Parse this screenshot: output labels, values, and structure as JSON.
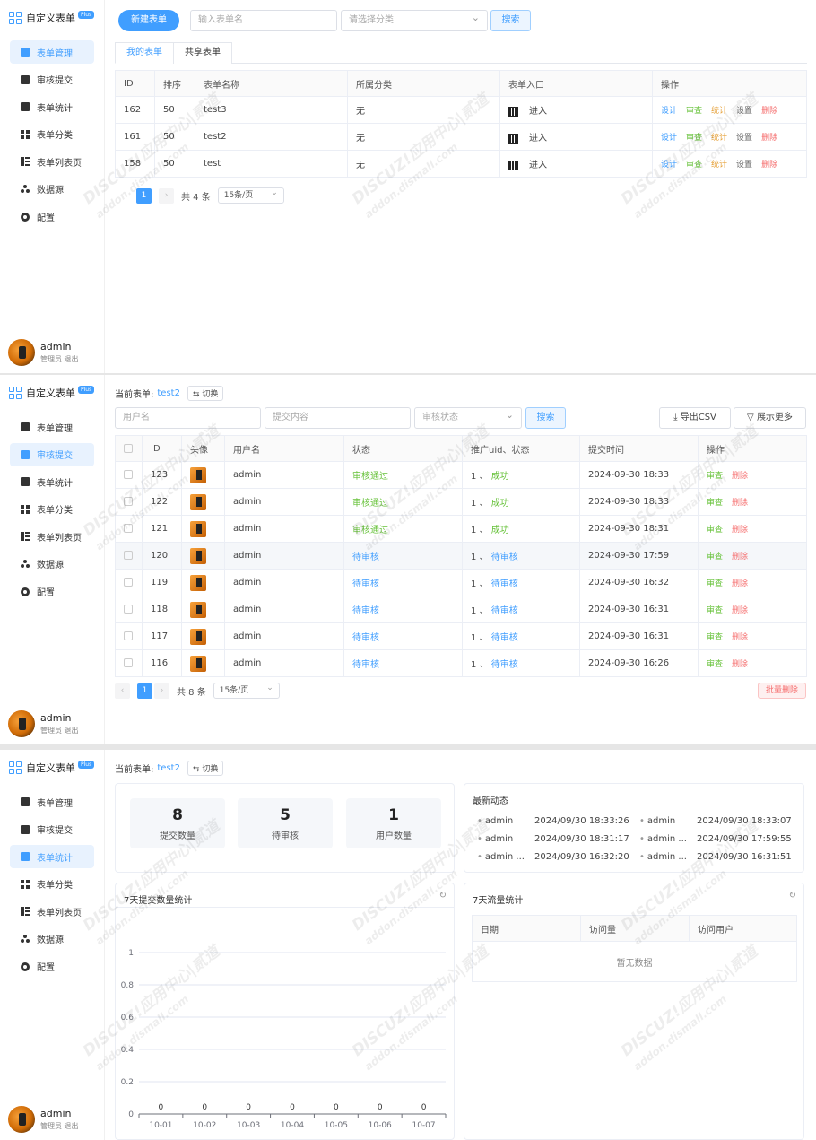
{
  "app": {
    "title": "自定义表单",
    "badge": "Plus"
  },
  "sidebar": {
    "items": [
      {
        "label": "表单管理",
        "icon": "form-icon"
      },
      {
        "label": "审核提交",
        "icon": "audit-icon"
      },
      {
        "label": "表单统计",
        "icon": "chart-icon"
      },
      {
        "label": "表单分类",
        "icon": "category-icon"
      },
      {
        "label": "表单列表页",
        "icon": "list-icon"
      },
      {
        "label": "数据源",
        "icon": "datasource-icon"
      },
      {
        "label": "配置",
        "icon": "gear-icon"
      }
    ]
  },
  "user": {
    "name": "admin",
    "role": "管理员",
    "logout": "退出"
  },
  "watermark": {
    "brand": "DISCUZ!应用中心",
    "site": "addon.dismall.com",
    "mark": "贰道"
  },
  "forms": {
    "new_button": "新建表单",
    "name_placeholder": "输入表单名",
    "category_placeholder": "请选择分类",
    "search": "搜索",
    "tabs": [
      "我的表单",
      "共享表单"
    ],
    "columns": [
      "ID",
      "排序",
      "表单名称",
      "所属分类",
      "表单入口",
      "操作"
    ],
    "rows": [
      {
        "id": "162",
        "order": "50",
        "name": "test3",
        "category": "无",
        "entry": "进入"
      },
      {
        "id": "161",
        "order": "50",
        "name": "test2",
        "category": "无",
        "entry": "进入"
      },
      {
        "id": "158",
        "order": "50",
        "name": "test",
        "category": "无",
        "entry": "进入"
      }
    ],
    "ops": [
      "设计",
      "审查",
      "统计",
      "设置",
      "删除"
    ],
    "pager": {
      "page": "1",
      "total": "共 4 条",
      "size": "15条/页"
    }
  },
  "submissions": {
    "current_label": "当前表单:",
    "current_form": "test2",
    "switch": "切换",
    "user_placeholder": "用户名",
    "content_placeholder": "提交内容",
    "status_placeholder": "审核状态",
    "search": "搜索",
    "export": "导出CSV",
    "more": "展示更多",
    "columns": [
      "ID",
      "头像",
      "用户名",
      "状态",
      "推广uid、状态",
      "提交时间",
      "操作"
    ],
    "rows": [
      {
        "id": "123",
        "user": "admin",
        "status": "审核通过",
        "uid": "1",
        "sep": "、",
        "promo": "成功",
        "time": "2024-09-30 18:33"
      },
      {
        "id": "122",
        "user": "admin",
        "status": "审核通过",
        "uid": "1",
        "sep": "、",
        "promo": "成功",
        "time": "2024-09-30 18:33"
      },
      {
        "id": "121",
        "user": "admin",
        "status": "审核通过",
        "uid": "1",
        "sep": "、",
        "promo": "成功",
        "time": "2024-09-30 18:31"
      },
      {
        "id": "120",
        "user": "admin",
        "status": "待审核",
        "uid": "1",
        "sep": "、",
        "promo": "待审核",
        "time": "2024-09-30 17:59"
      },
      {
        "id": "119",
        "user": "admin",
        "status": "待审核",
        "uid": "1",
        "sep": "、",
        "promo": "待审核",
        "time": "2024-09-30 16:32"
      },
      {
        "id": "118",
        "user": "admin",
        "status": "待审核",
        "uid": "1",
        "sep": "、",
        "promo": "待审核",
        "time": "2024-09-30 16:31"
      },
      {
        "id": "117",
        "user": "admin",
        "status": "待审核",
        "uid": "1",
        "sep": "、",
        "promo": "待审核",
        "time": "2024-09-30 16:31"
      },
      {
        "id": "116",
        "user": "admin",
        "status": "待审核",
        "uid": "1",
        "sep": "、",
        "promo": "待审核",
        "time": "2024-09-30 16:26"
      }
    ],
    "ops": [
      "审查",
      "删除"
    ],
    "pager": {
      "page": "1",
      "total": "共 8 条",
      "size": "15条/页"
    },
    "batch_delete": "批量删除"
  },
  "stats": {
    "current_label": "当前表单:",
    "current_form": "test2",
    "switch": "切换",
    "cards": [
      {
        "value": "8",
        "label": "提交数量"
      },
      {
        "value": "5",
        "label": "待审核"
      },
      {
        "value": "1",
        "label": "用户数量"
      }
    ],
    "feed_title": "最新动态",
    "feed": [
      {
        "user": "admin",
        "time": "2024/09/30 18:33:26"
      },
      {
        "user": "admin",
        "time": "2024/09/30 18:33:07"
      },
      {
        "user": "admin",
        "time": "2024/09/30 18:31:17"
      },
      {
        "user": "admin ...",
        "time": "2024/09/30 17:59:55"
      },
      {
        "user": "admin ...",
        "time": "2024/09/30 16:32:20"
      },
      {
        "user": "admin ...",
        "time": "2024/09/30 16:31:51"
      }
    ],
    "chart_title": "7天提交数量统计",
    "traffic_title": "7天流量统计",
    "traffic_columns": [
      "日期",
      "访问量",
      "访问用户"
    ],
    "traffic_empty": "暂无数据"
  },
  "chart_data": {
    "type": "bar",
    "title": "7天提交数量统计",
    "categories": [
      "10-01",
      "10-02",
      "10-03",
      "10-04",
      "10-05",
      "10-06",
      "10-07"
    ],
    "values": [
      0,
      0,
      0,
      0,
      0,
      0,
      0
    ],
    "yticks": [
      "0",
      "0.2",
      "0.4",
      "0.6",
      "0.8",
      "1"
    ],
    "ylim": [
      0,
      1
    ],
    "grid": true,
    "colors": {
      "axis": "#6e7079",
      "grid": "#e0e6f1"
    }
  },
  "colors": {
    "primary": "#409eff",
    "success": "#67c23a",
    "warning": "#e6a23c",
    "danger": "#f56c6c"
  }
}
